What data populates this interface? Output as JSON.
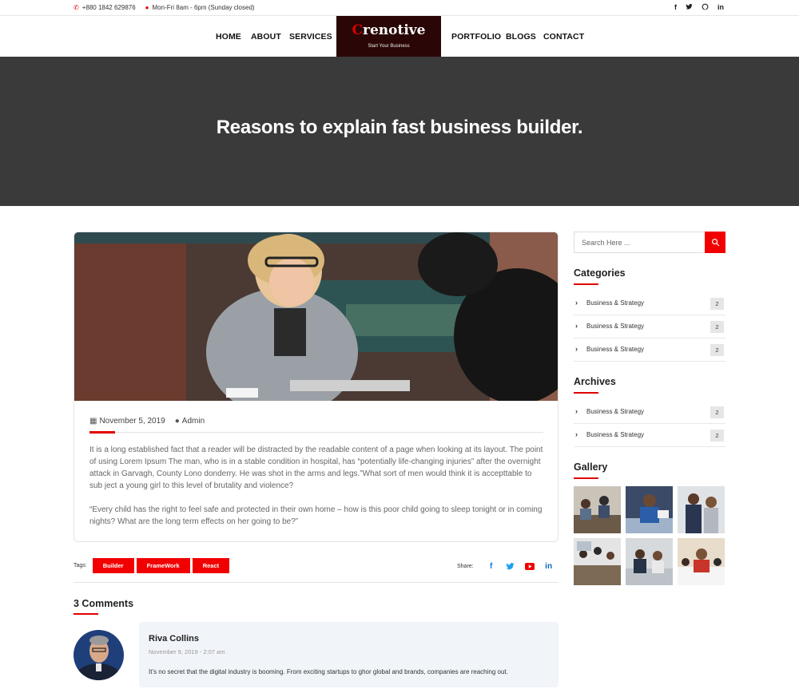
{
  "topbar": {
    "phone": "+880 1842 629876",
    "hours": "Mon-Fri 8am - 6pm (Sunday closed)",
    "social": [
      "facebook-icon",
      "twitter-icon",
      "github-icon",
      "linkedin-icon"
    ]
  },
  "nav": {
    "home": "HOME",
    "about": "ABOUT",
    "services": "SERVICES",
    "portfolio": "PORTFOLIO",
    "blogs": "BLOGS",
    "contact": "CONTACT",
    "logo_letter": "C",
    "logo_text": "renotive",
    "logo_tagline": "Start Your Business"
  },
  "hero": {
    "title": "Reasons to explain fast business builder."
  },
  "post": {
    "date": "November 5, 2019",
    "author": "Admin",
    "paragraph1": "It is a long established fact that a reader will be distracted by the readable content of a page when looking at its layout. The point of using Lorem Ipsum The man, who is in a stable condition in hospital, has “potentially life-changing injuries” after the overnight attack in Garvagh, County Lono donderry. He was shot in the arms and legs.”What sort of men would think it is accepttable to sub ject a young girl to this level of brutality and violence?",
    "paragraph2": "“Every child has the right to feel safe and protected in their own home – how is this poor child going to sleep tonight or in coming nights? What are the long term effects on her going to be?”"
  },
  "tags": {
    "label": "Tags:",
    "items": [
      "Builder",
      "FrameWork",
      "React"
    ]
  },
  "share": {
    "label": "Share:"
  },
  "comments": {
    "title": "3 Comments",
    "items": [
      {
        "name": "Riva Collins",
        "date": "November 9, 2019 - 2:07 am",
        "text": "It’s no secret that the digital industry is booming. From exciting startups to ghor global and brands, companies are reaching out."
      }
    ]
  },
  "sidebar": {
    "search_placeholder": "Search Here ...",
    "categories_title": "Categories",
    "categories": [
      {
        "label": "Business & Strategy",
        "count": "2"
      },
      {
        "label": "Business & Strategy",
        "count": "2"
      },
      {
        "label": "Business & Strategy",
        "count": "2"
      }
    ],
    "archives_title": "Archives",
    "archives": [
      {
        "label": "Business & Strategy",
        "count": "2"
      },
      {
        "label": "Business & Strategy",
        "count": "2"
      }
    ],
    "gallery_title": "Gallery"
  },
  "colors": {
    "accent": "#f20000",
    "hero_bg": "#3a3a3a",
    "logo_bg": "#2a0606"
  }
}
